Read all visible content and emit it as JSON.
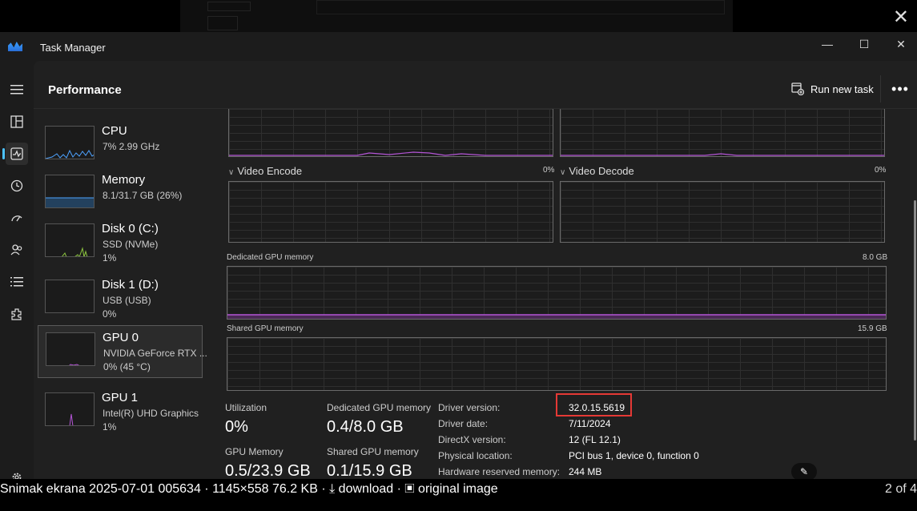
{
  "window": {
    "title": "Task Manager"
  },
  "header": {
    "page_title": "Performance",
    "run_new_task": "Run new task"
  },
  "devices": [
    {
      "name": "CPU",
      "sub1": "7%  2.99 GHz",
      "sub2": ""
    },
    {
      "name": "Memory",
      "sub1": "8.1/31.7 GB (26%)",
      "sub2": ""
    },
    {
      "name": "Disk 0 (C:)",
      "sub1": "SSD (NVMe)",
      "sub2": "1%"
    },
    {
      "name": "Disk 1 (D:)",
      "sub1": "USB (USB)",
      "sub2": "0%"
    },
    {
      "name": "GPU 0",
      "sub1": "NVIDIA GeForce RTX ...",
      "sub2": "0%  (45 °C)"
    },
    {
      "name": "GPU 1",
      "sub1": "Intel(R) UHD Graphics",
      "sub2": "1%"
    }
  ],
  "graphs": {
    "video_encode": {
      "label": "Video Encode",
      "value": "0%"
    },
    "video_decode": {
      "label": "Video Decode",
      "value": "0%"
    },
    "dedicated": {
      "label": "Dedicated GPU memory",
      "max": "8.0 GB"
    },
    "shared": {
      "label": "Shared GPU memory",
      "max": "15.9 GB"
    }
  },
  "stats": {
    "utilization_label": "Utilization",
    "utilization_value": "0%",
    "dedicated_label": "Dedicated GPU memory",
    "dedicated_value": "0.4/8.0 GB",
    "gpu_memory_label": "GPU Memory",
    "gpu_memory_value": "0.5/23.9 GB",
    "shared_label": "Shared GPU memory",
    "shared_value": "0.1/15.9 GB"
  },
  "details": [
    {
      "label": "Driver version:",
      "value": "32.0.15.5619"
    },
    {
      "label": "Driver date:",
      "value": "7/11/2024"
    },
    {
      "label": "DirectX version:",
      "value": "12 (FL 12.1)"
    },
    {
      "label": "Physical location:",
      "value": "PCI bus 1, device 0, function 0"
    },
    {
      "label": "Hardware reserved memory:",
      "value": "244 MB"
    }
  ],
  "caption": {
    "filename": "Snimak ekrana 2025-07-01 005634",
    "meta": "1145×558 76.2 KB",
    "download": "download",
    "original": "original image",
    "counter": "2 of 4"
  },
  "colors": {
    "accent": "#4cc2ff",
    "gpu_line": "#b455d6",
    "highlight": "#e53935"
  }
}
